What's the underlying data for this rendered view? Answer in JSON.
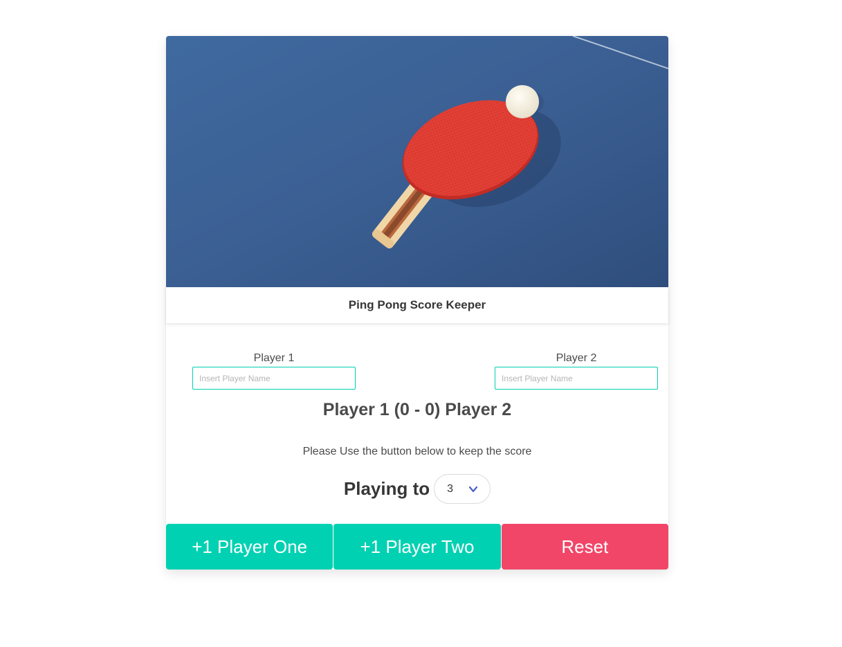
{
  "card": {
    "header_title": "Ping Pong Score Keeper"
  },
  "players": [
    {
      "label": "Player 1",
      "placeholder": "Insert Player Name",
      "value": ""
    },
    {
      "label": "Player 2",
      "placeholder": "Insert Player Name",
      "value": ""
    }
  ],
  "score": {
    "display": "Player 1 (0 - 0) Player 2",
    "player1_name": "Player 1",
    "player2_name": "Player 2",
    "player1_score": 0,
    "player2_score": 0
  },
  "instructions": "Please Use the button below to keep the score",
  "playing_to": {
    "label": "Playing to",
    "selected": "3"
  },
  "buttons": {
    "player_one": "+1 Player One",
    "player_two": "+1 Player Two",
    "reset": "Reset"
  },
  "colors": {
    "primary": "#00d1b2",
    "danger": "#f14668",
    "table_blue": "#3c6194",
    "paddle_red": "#e23f35"
  },
  "icons": {
    "select_arrow": "chevron-down-icon",
    "hero": "ping-pong-paddle-and-ball-image"
  }
}
